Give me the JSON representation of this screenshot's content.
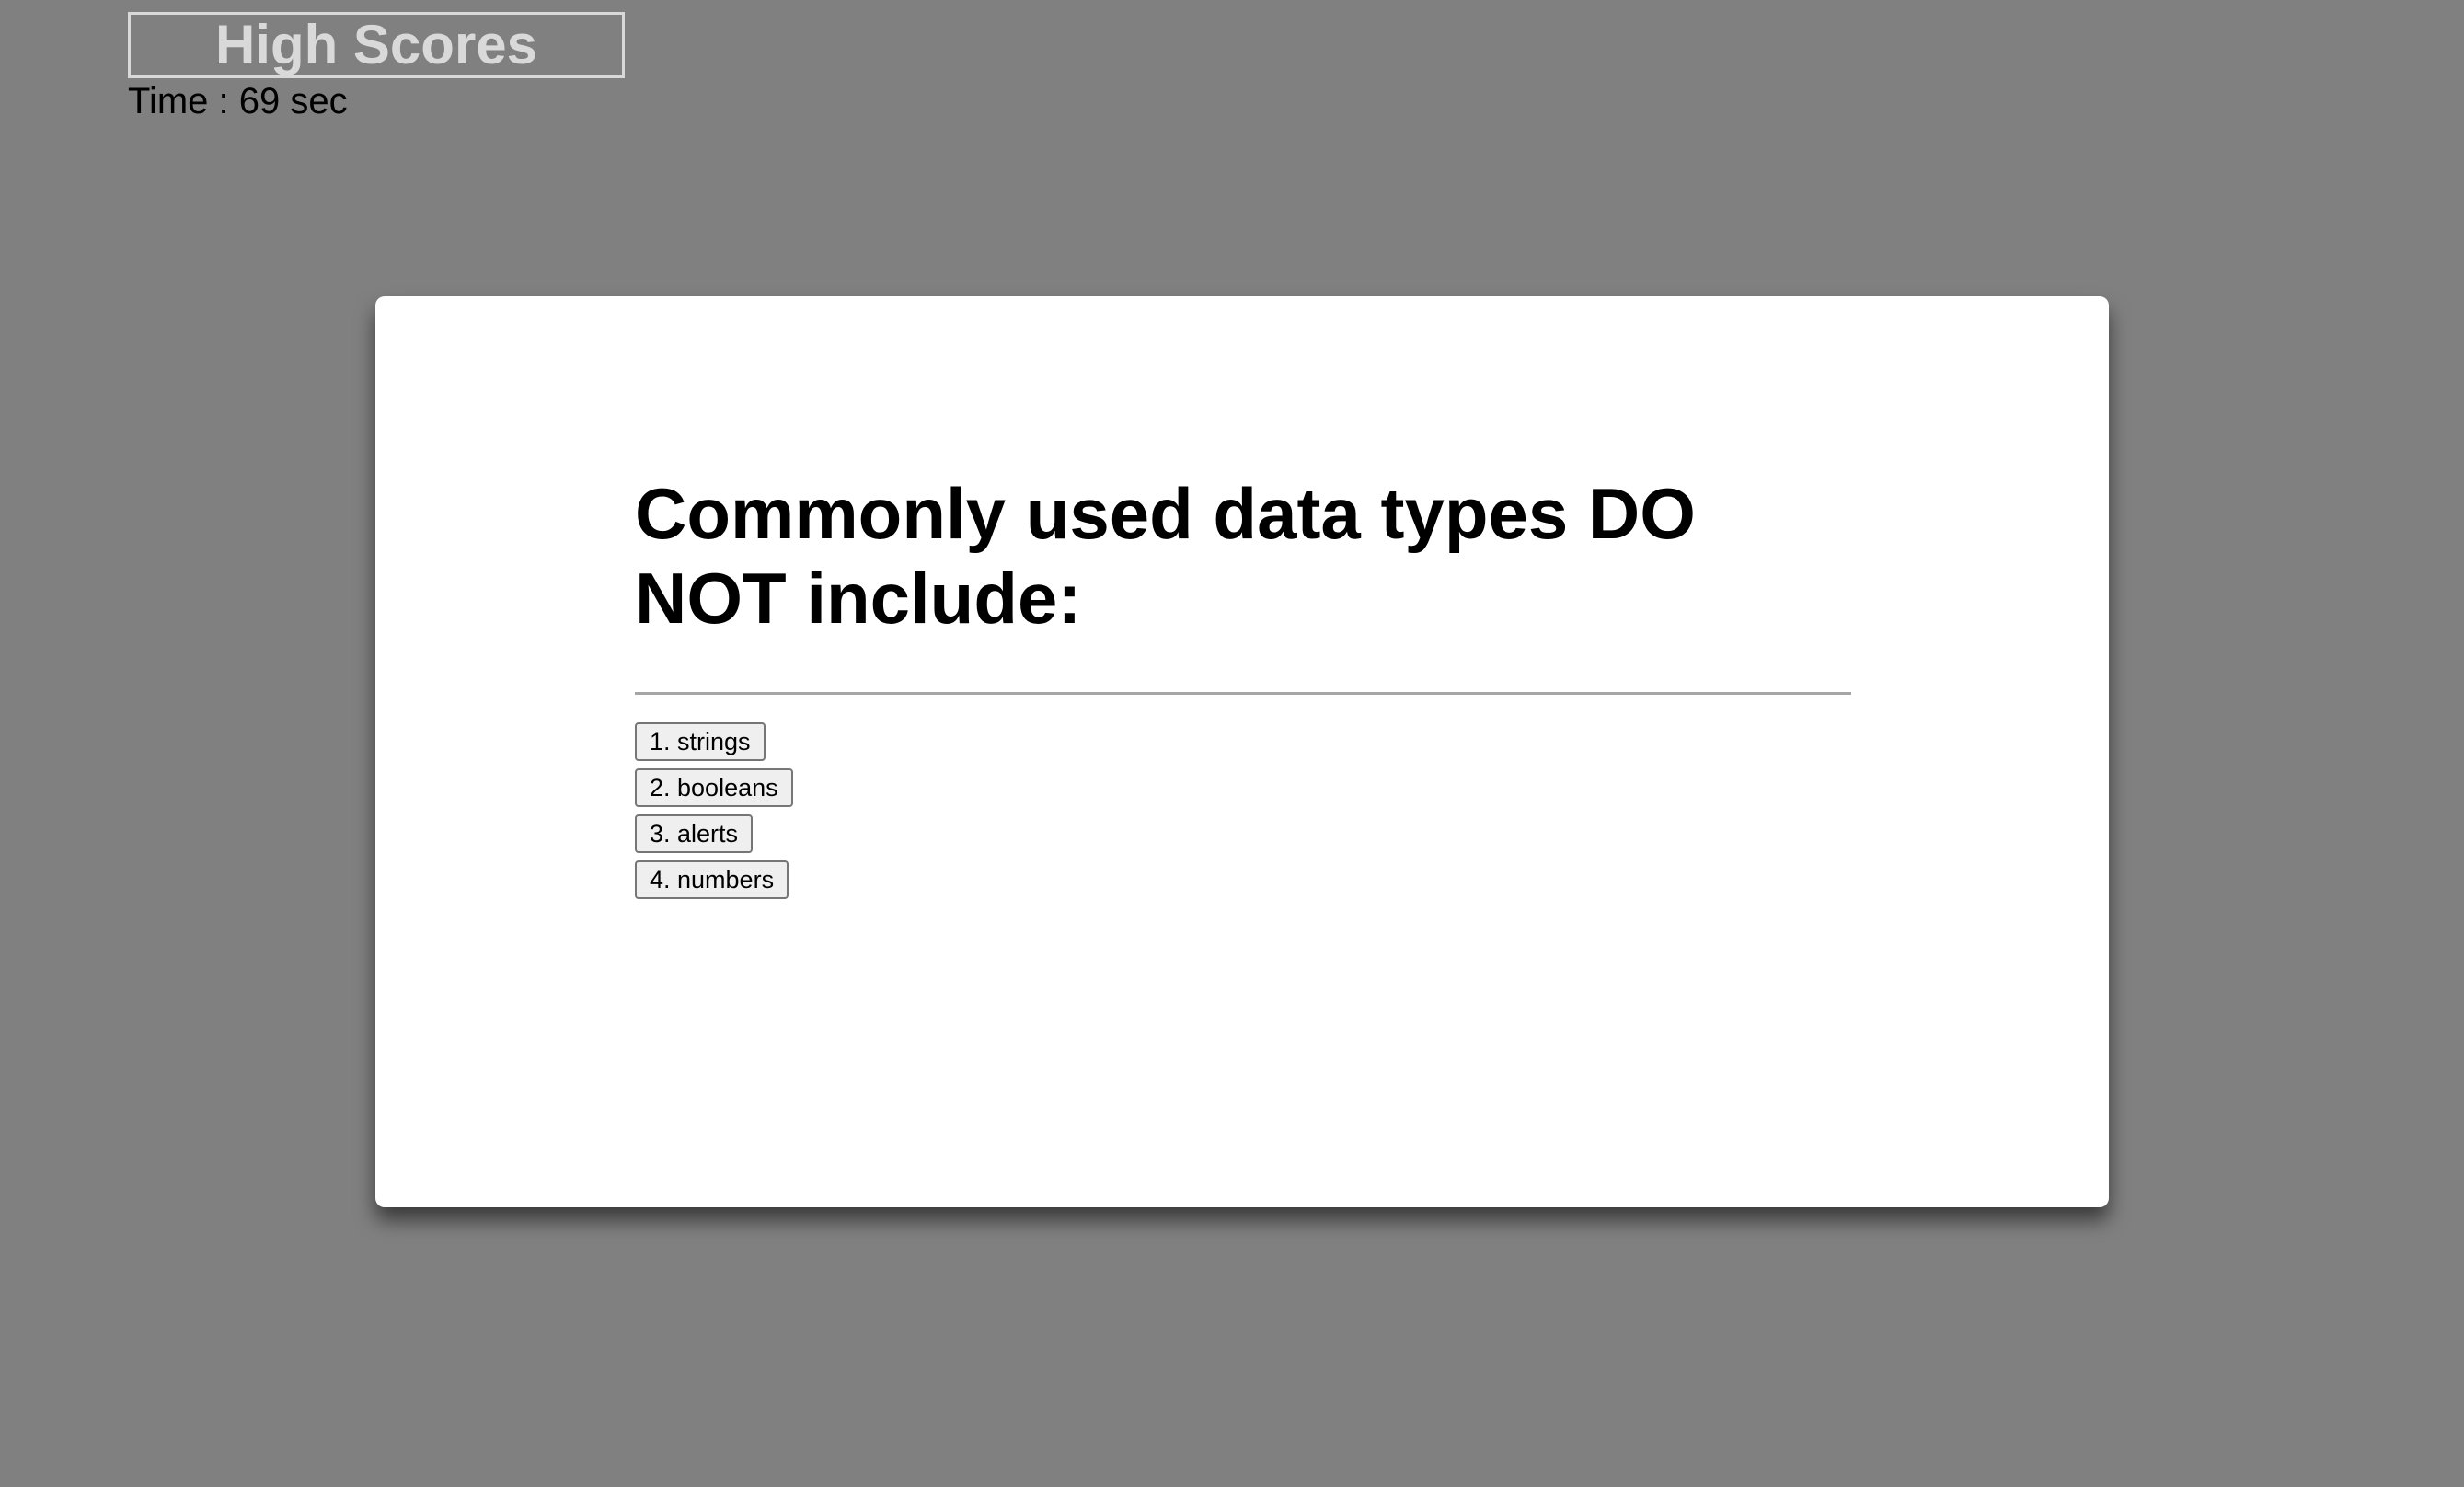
{
  "header": {
    "high_scores_label": "High Scores",
    "timer_text": "Time : 69 sec"
  },
  "quiz": {
    "question": "Commonly used data types DO NOT include:",
    "answers": [
      "1. strings",
      "2. booleans",
      "3. alerts",
      "4. numbers"
    ]
  }
}
